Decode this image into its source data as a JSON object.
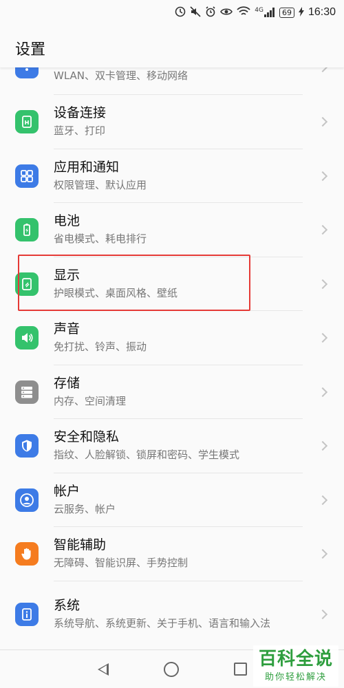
{
  "status_bar": {
    "icons": [
      "data-saver-icon",
      "mute-icon",
      "alarm-icon",
      "eye-comfort-icon",
      "wifi-icon",
      "signal-icon"
    ],
    "network": "4G",
    "battery": "69",
    "time": "16:30"
  },
  "header": {
    "title": "设置"
  },
  "settings": [
    {
      "title": "",
      "subtitle": "WLAN、双卡管理、移动网络",
      "icon": "network-icon",
      "color": "#3d7be6"
    },
    {
      "title": "设备连接",
      "subtitle": "蓝牙、打印",
      "icon": "device-connection-icon",
      "color": "#34c26c"
    },
    {
      "title": "应用和通知",
      "subtitle": "权限管理、默认应用",
      "icon": "apps-icon",
      "color": "#3d7be6"
    },
    {
      "title": "电池",
      "subtitle": "省电模式、耗电排行",
      "icon": "battery-icon",
      "color": "#34c26c"
    },
    {
      "title": "显示",
      "subtitle": "护眼模式、桌面风格、壁纸",
      "icon": "display-icon",
      "color": "#34c26c"
    },
    {
      "title": "声音",
      "subtitle": "免打扰、铃声、振动",
      "icon": "sound-icon",
      "color": "#34c26c"
    },
    {
      "title": "存储",
      "subtitle": "内存、空间清理",
      "icon": "storage-icon",
      "color": "#8e8e8e"
    },
    {
      "title": "安全和隐私",
      "subtitle": "指纹、人脸解锁、锁屏和密码、学生模式",
      "icon": "shield-icon",
      "color": "#3d7be6"
    },
    {
      "title": "帐户",
      "subtitle": "云服务、帐户",
      "icon": "account-icon",
      "color": "#3d7be6"
    },
    {
      "title": "智能辅助",
      "subtitle": "无障碍、智能识屏、手势控制",
      "icon": "hand-icon",
      "color": "#f57c1f"
    },
    {
      "title": "系统",
      "subtitle": "系统导航、系统更新、关于手机、语言和输入法",
      "icon": "system-info-icon",
      "color": "#3d7be6"
    }
  ],
  "watermark": {
    "main": "百科全说",
    "sub": "助你轻松解决"
  },
  "colors": {
    "highlight": "#e53935",
    "green": "#34c26c",
    "blue": "#3d7be6",
    "orange": "#f57c1f",
    "gray": "#8e8e8e"
  }
}
